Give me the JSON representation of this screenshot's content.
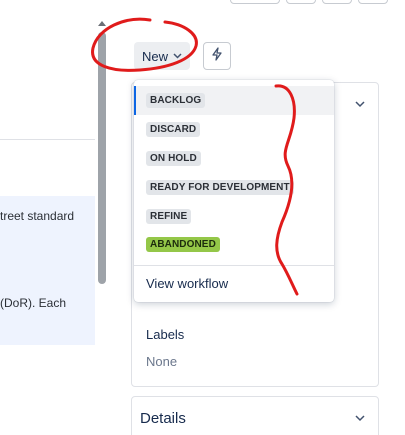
{
  "left_pane": {
    "lines": [
      "treet standard",
      "(DoR). Each"
    ]
  },
  "header": {
    "status_label": "New",
    "status_chevron_icon": "chevron-down-icon",
    "action_icon": "lightning-bolt-icon"
  },
  "dropdown": {
    "options": [
      {
        "label": "BACKLOG",
        "selected": true,
        "color": "#e2e5e9"
      },
      {
        "label": "DISCARD",
        "selected": false,
        "color": "#e2e5e9"
      },
      {
        "label": "ON HOLD",
        "selected": false,
        "color": "#e2e5e9"
      },
      {
        "label": "READY FOR DEVELOPMENT",
        "selected": false,
        "color": "#e2e5e9"
      },
      {
        "label": "REFINE",
        "selected": false,
        "color": "#e2e5e9"
      },
      {
        "label": "ABANDONED",
        "selected": false,
        "color": "#94c748"
      }
    ],
    "footer_link": "View workflow"
  },
  "panel": {
    "labels_title": "Labels",
    "labels_value": "None"
  },
  "details": {
    "title": "Details"
  },
  "colors": {
    "selection_accent": "#0c66e4",
    "annotation_red": "#e01b1b"
  }
}
